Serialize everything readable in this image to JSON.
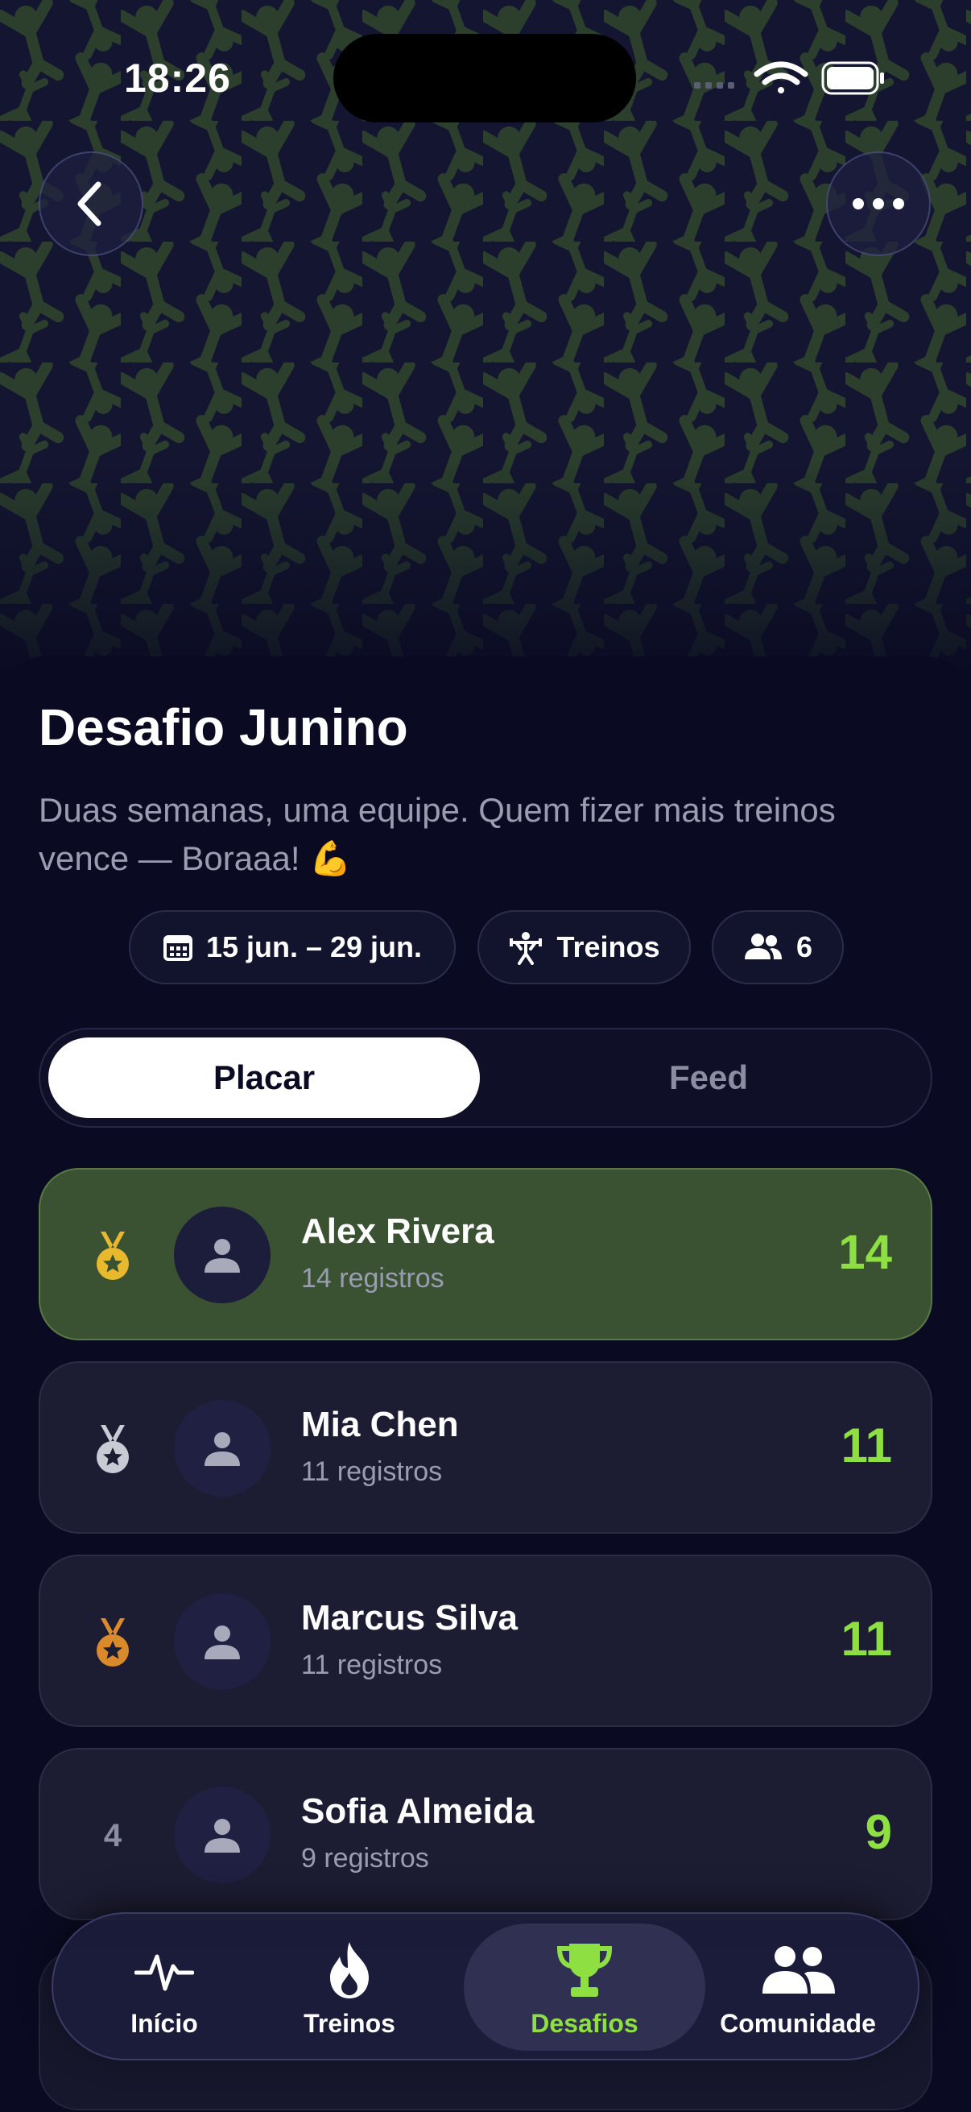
{
  "status_bar": {
    "time": "18:26"
  },
  "challenge": {
    "title": "Desafio Junino",
    "description": "Duas semanas, uma equipe. Quem fizer mais treinos vence — Boraaa! 💪",
    "chips": {
      "date_range": "15 jun. – 29 jun.",
      "type": "Treinos",
      "participants": "6"
    }
  },
  "tabs": {
    "leaderboard": "Placar",
    "feed": "Feed",
    "active": "Placar"
  },
  "leaderboard": [
    {
      "rank": "1",
      "medal": "gold-medal-icon",
      "name": "Alex Rivera",
      "entries": "14 registros",
      "score": "14"
    },
    {
      "rank": "2",
      "medal": "silver-medal-icon",
      "name": "Mia Chen",
      "entries": "11 registros",
      "score": "11"
    },
    {
      "rank": "3",
      "medal": "bronze-medal-icon",
      "name": "Marcus Silva",
      "entries": "11 registros",
      "score": "11"
    },
    {
      "rank": "4",
      "medal": "",
      "name": "Sofia Almeida",
      "entries": "9 registros",
      "score": "9"
    }
  ],
  "nav": {
    "items": [
      {
        "label": "Início",
        "icon": "heartbeat-icon"
      },
      {
        "label": "Treinos",
        "icon": "flame-icon"
      },
      {
        "label": "Desafios",
        "icon": "trophy-icon"
      },
      {
        "label": "Comunidade",
        "icon": "people-icon"
      }
    ],
    "active": "Desafios"
  },
  "colors": {
    "background": "#0a0b22",
    "accent_green": "#8ee042",
    "leader_row": "#3b5232",
    "gold": "#e8b92c",
    "silver": "#c9cbd4",
    "bronze": "#d98a2b"
  }
}
